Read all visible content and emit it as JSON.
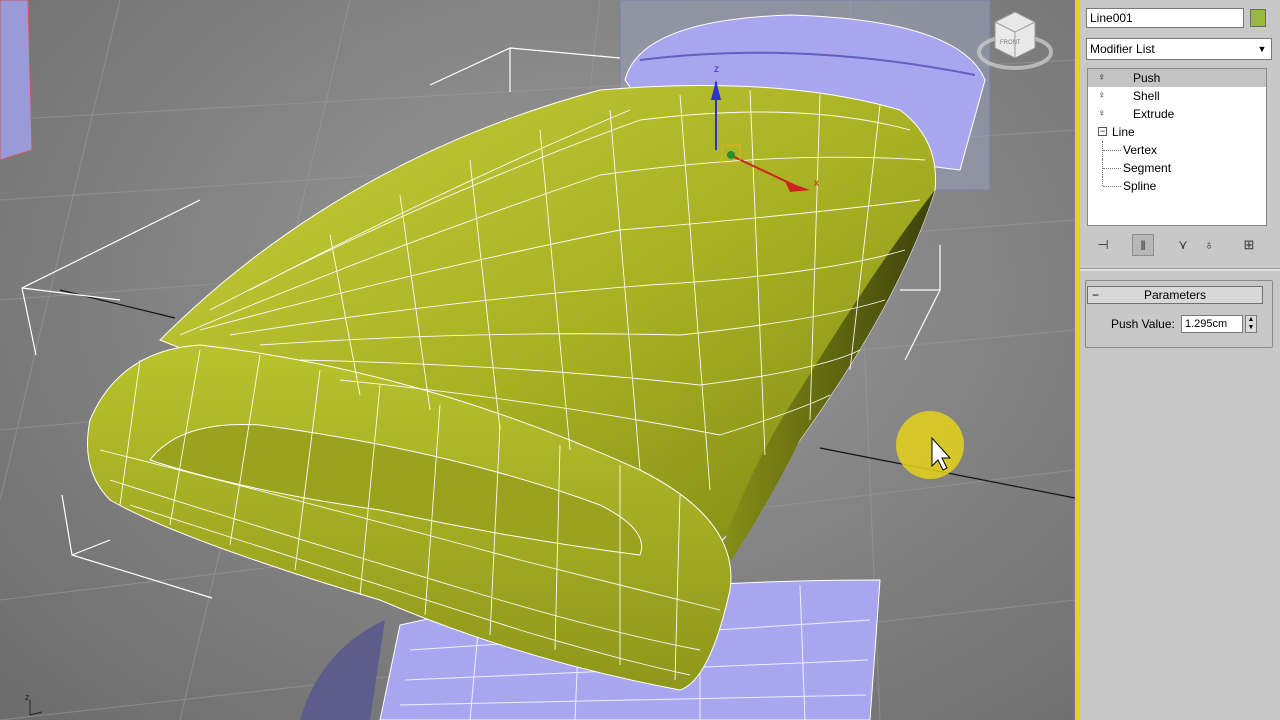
{
  "object": {
    "name": "Line001",
    "color": "#99b93a"
  },
  "modifier_list": {
    "label": "Modifier List"
  },
  "stack": {
    "modifiers": [
      {
        "label": "Push",
        "selected": true
      },
      {
        "label": "Shell"
      },
      {
        "label": "Extrude"
      }
    ],
    "base": {
      "label": "Line",
      "expand": "−"
    },
    "subobjects": [
      {
        "label": "Vertex"
      },
      {
        "label": "Segment"
      },
      {
        "label": "Spline"
      }
    ]
  },
  "parameters": {
    "title": "Parameters",
    "collapse": "−",
    "push_label": "Push Value:",
    "push_value": "1.295cm"
  },
  "viewcube": {
    "label": "FRONT"
  },
  "gizmo": {
    "z_label": "z",
    "x_label": "x"
  },
  "axis_tripod": {
    "z_label": "z"
  },
  "colors": {
    "mesh": "#a3ad22",
    "wire": "#ffffff",
    "proxy": "#a9a6f0",
    "highlight": "#e6d21a"
  }
}
